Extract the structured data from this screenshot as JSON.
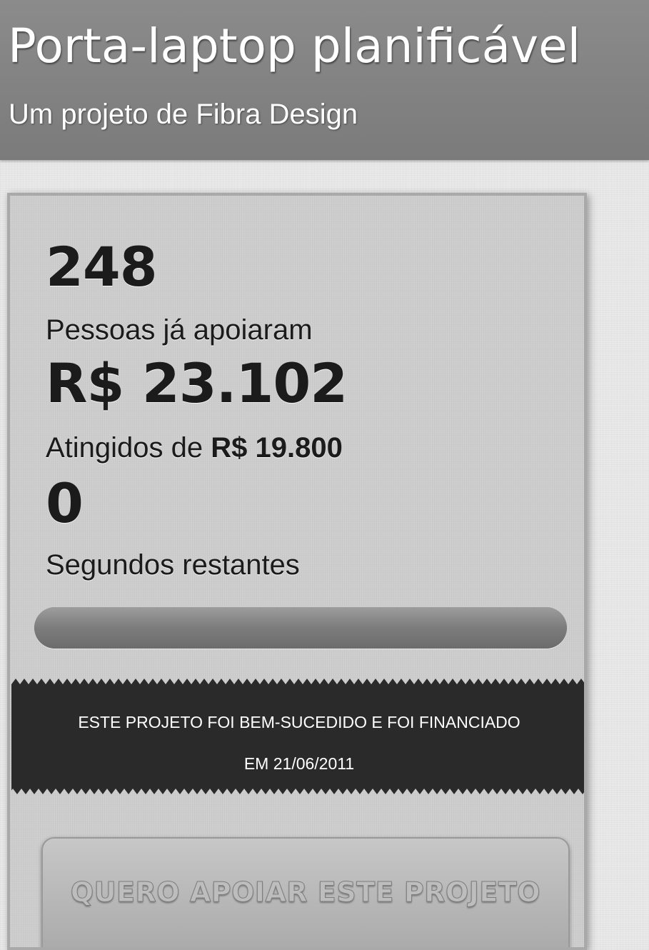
{
  "header": {
    "title": "Porta-laptop planificável",
    "subtitle": "Um projeto de Fibra Design"
  },
  "stats": {
    "backers_count": "248",
    "backers_label": "Pessoas já apoiaram",
    "pledged_amount": "R$ 23.102",
    "goal_label_prefix": "Atingidos de ",
    "goal_amount": "R$ 19.800",
    "seconds_count": "0",
    "seconds_label": "Segundos restantes"
  },
  "progress": {
    "percent_funded": 100
  },
  "banner": {
    "line1": "ESTE PROJETO FOI BEM-SUCEDIDO E FOI FINANCIADO",
    "line2": "EM 21/06/2011"
  },
  "button": {
    "label": "QUERO APOIAR ESTE PROJETO"
  }
}
